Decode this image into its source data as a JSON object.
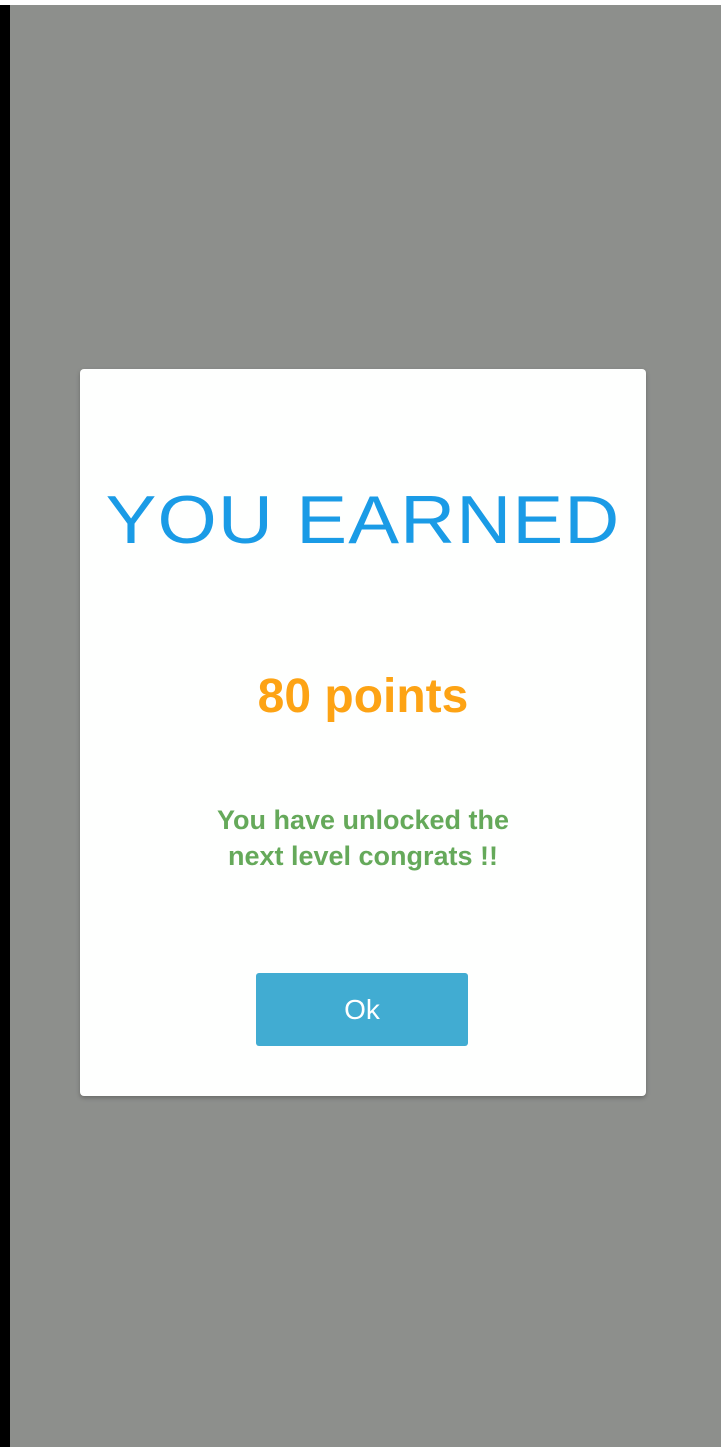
{
  "dialog": {
    "title": "YOU EARNED",
    "points": "80 points",
    "message": "You have unlocked the\n next level congrats  !!",
    "ok_label": "Ok"
  },
  "colors": {
    "overlay": "#8d8f8c",
    "dialog_bg": "#fefffe",
    "title": "#1a9be6",
    "points": "#fda314",
    "message": "#65a95a",
    "button": "#41acd2"
  }
}
